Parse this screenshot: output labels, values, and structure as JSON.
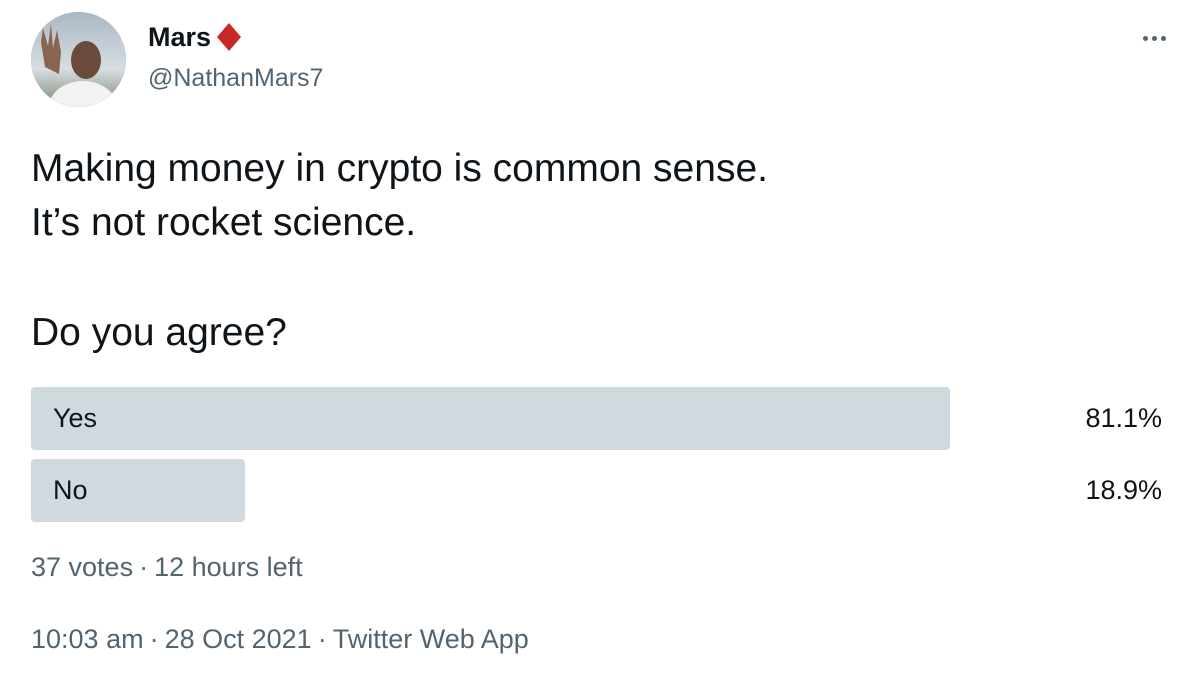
{
  "author": {
    "display_name": "Mars",
    "handle": "@NathanMars7",
    "badge_icon": "diamond-icon",
    "badge_color": "#c62828"
  },
  "menu": {
    "icon": "more-options-icon"
  },
  "tweet": {
    "lines": [
      "Making money in crypto is common sense.",
      "It’s not rocket science.",
      "Do you agree?"
    ]
  },
  "poll": {
    "options": [
      {
        "label": "Yes",
        "percent_text": "81.1%",
        "percent": 81.1
      },
      {
        "label": "No",
        "percent_text": "18.9%",
        "percent": 18.9
      }
    ],
    "votes": "37 votes",
    "time_left": "12 hours left",
    "separator": "·",
    "bar_color": "#cfd9de"
  },
  "footer": {
    "time": "10:03 am",
    "date": "28 Oct 2021",
    "source": "Twitter Web App",
    "separator": "·"
  }
}
